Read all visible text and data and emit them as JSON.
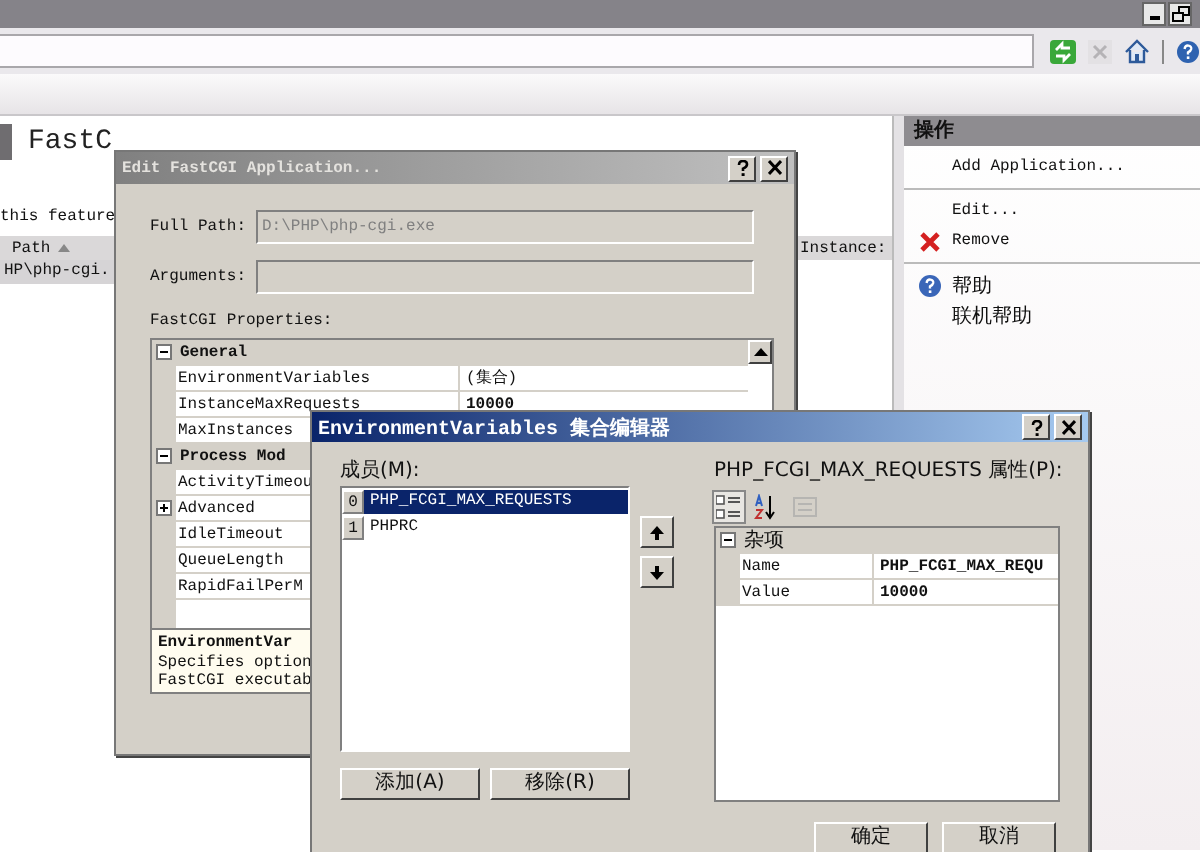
{
  "main": {
    "heading": "FastC",
    "description": "this feature",
    "columns": [
      {
        "label": "Path",
        "sorted": true
      },
      {
        "label": "Instance:",
        "sorted": false
      }
    ],
    "rows": [
      {
        "cells": [
          "HP\\php-cgi."
        ],
        "selected": true
      }
    ]
  },
  "actions": {
    "title": "操作",
    "groups": [
      [
        {
          "label": "Add Application...",
          "kind": "plain"
        }
      ],
      [
        {
          "label": "Edit...",
          "kind": "plain"
        },
        {
          "label": "Remove",
          "kind": "remove"
        }
      ],
      [
        {
          "label": "帮助",
          "kind": "help"
        },
        {
          "label": "联机帮助",
          "kind": "plain"
        }
      ]
    ]
  },
  "edit_dialog": {
    "title": "Edit FastCGI Application...",
    "active": false,
    "fields": [
      {
        "label": "Full Path:",
        "value": "D:\\PHP\\php-cgi.exe",
        "disabled": true
      },
      {
        "label": "Arguments:",
        "disabled": true
      }
    ],
    "properties_label": "FastCGI Properties:",
    "grid": [
      {
        "kind": "category",
        "label": "General",
        "expanded": true
      },
      {
        "kind": "property",
        "name": "EnvironmentVariables",
        "value": "(集合)",
        "modified": false
      },
      {
        "kind": "property",
        "name": "InstanceMaxRequests",
        "value": "10000",
        "modified": true
      },
      {
        "kind": "property",
        "name": "MaxInstances"
      },
      {
        "kind": "category",
        "label": "Process Mod",
        "expanded": true
      },
      {
        "kind": "property",
        "name": "ActivityTimeou"
      },
      {
        "kind": "expandable",
        "name": "Advanced",
        "expanded": false
      },
      {
        "kind": "property",
        "name": "IdleTimeout"
      },
      {
        "kind": "property",
        "name": "QueueLength"
      },
      {
        "kind": "property",
        "name": "RapidFailPerM"
      }
    ],
    "description": {
      "title": "EnvironmentVar",
      "lines": [
        "Specifies option",
        "FastCGI executab"
      ]
    }
  },
  "env_dialog": {
    "title": "EnvironmentVariables 集合编辑器",
    "active": true,
    "members_label": "成员(M):",
    "members": [
      {
        "index": "0",
        "name": "PHP_FCGI_MAX_REQUESTS",
        "selected": true
      },
      {
        "index": "1",
        "name": "PHPRC",
        "selected": false
      }
    ],
    "properties_label": "PHP_FCGI_MAX_REQUESTS 属性(P):",
    "view_buttons": [
      {
        "kind": "categorized",
        "selected": true
      },
      {
        "kind": "alphabetical",
        "selected": false
      },
      {
        "kind": "pages",
        "disabled": true
      }
    ],
    "grid": [
      {
        "kind": "category",
        "label": "杂项",
        "expanded": true
      },
      {
        "kind": "property",
        "name": "Name",
        "value": "PHP_FCGI_MAX_REQU",
        "modified": true
      },
      {
        "kind": "property",
        "name": "Value",
        "value": "10000",
        "modified": true
      }
    ],
    "list_buttons": [
      "添加(A)",
      "移除(R)"
    ],
    "dialog_buttons": [
      "确定",
      "取消"
    ]
  }
}
